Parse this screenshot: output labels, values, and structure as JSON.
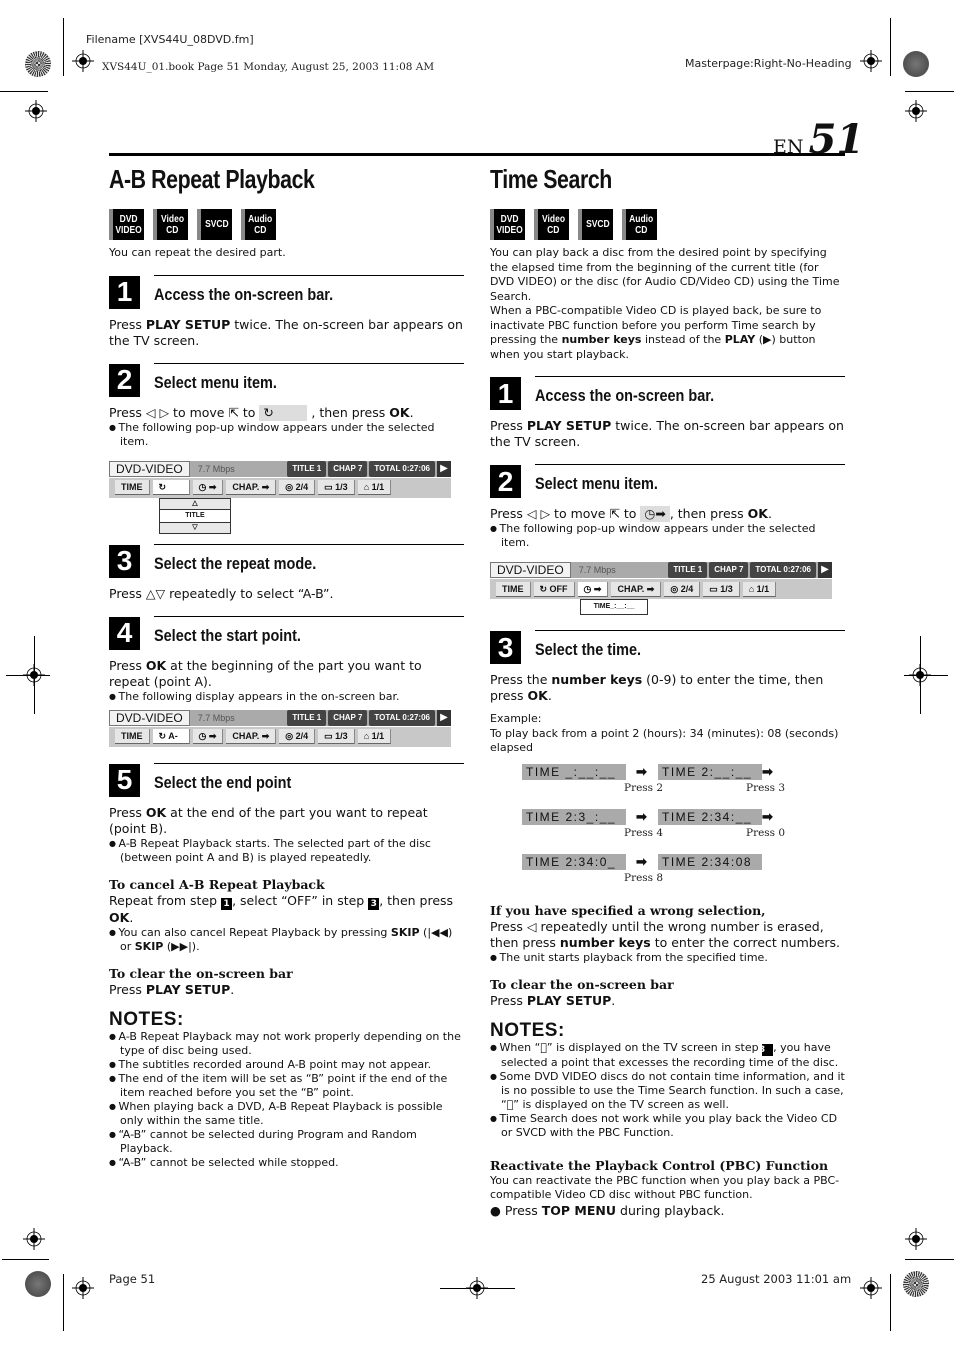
{
  "header": {
    "filename": "Filename [XVS44U_08DVD.fm]",
    "book_info": "XVS44U_01.book  Page 51  Monday, August 25, 2003  11:08 AM",
    "masterpage": "Masterpage:Right-No-Heading",
    "lang": "EN",
    "page_number": "51"
  },
  "footer": {
    "page_label": "Page 51",
    "date": "25 August 2003 11:01 am"
  },
  "badges": [
    {
      "line1": "DVD",
      "line2": "VIDEO"
    },
    {
      "line1": "Video",
      "line2": "CD"
    },
    {
      "line1": "SVCD",
      "line2": ""
    },
    {
      "line1": "Audio",
      "line2": "CD"
    }
  ],
  "ab_repeat": {
    "title": "A-B Repeat Playback",
    "intro": "You can repeat the desired part.",
    "steps": [
      {
        "num": "1",
        "title": "Access the on-screen bar.",
        "body_pre": "Press ",
        "body_bold": "PLAY SETUP",
        "body_post": " twice. The on-screen bar appears on the TV screen."
      },
      {
        "num": "2",
        "title": "Select menu item.",
        "body_pre": "Press ◁ ▷ to move ⇱ to ",
        "body_icon": "↻",
        "body_post": " , then press ",
        "body_ok": "OK",
        "bullet": "The following pop-up window appears under the selected item."
      },
      {
        "num": "3",
        "title": "Select the repeat mode.",
        "body": "Press △▽ repeatedly to select “A-B”."
      },
      {
        "num": "4",
        "title": "Select the start point.",
        "body_pre": "Press ",
        "body_bold": "OK",
        "body_post": " at the beginning of the part you want to repeat (point A).",
        "bullet": "The following display appears in the on-screen bar."
      },
      {
        "num": "5",
        "title": "Select the end point",
        "body_pre": "Press ",
        "body_bold": "OK",
        "body_post": " at the end of the part you want to repeat (point B).",
        "bullet": "A-B Repeat Playback starts. The selected part of the disc (between point A and B) is played repeatedly."
      }
    ],
    "cancel": {
      "heading": "To cancel A-B Repeat Playback",
      "body_pre": "Repeat from step ",
      "step_a": "1",
      "body_mid": ", select “OFF” in step ",
      "step_b": "3",
      "body_post": ", then press ",
      "ok": "OK",
      "bullet_pre": "You can also cancel Repeat Playback by pressing ",
      "skip1": "SKIP",
      "skip1_sym": " (|◀◀)",
      "bullet_mid": " or ",
      "skip2": "SKIP",
      "skip2_sym": " (▶▶|)."
    },
    "clear": {
      "heading": "To clear the on-screen bar",
      "body_pre": "Press ",
      "body_bold": "PLAY SETUP",
      "body_post": "."
    },
    "notes_title": "NOTES:",
    "notes": [
      "A-B Repeat Playback may not work properly depending on the type of disc being used.",
      "The subtitles recorded around A-B point may not appear.",
      "The end of the item will be set as “B” point if the end of the item reached before you set the “B” point.",
      "When playing back a DVD, A-B Repeat Playback is possible only within the same title.",
      "“A-B” cannot be selected during Program and Random Playback.",
      "“A-B” cannot be selected while stopped."
    ]
  },
  "osb": {
    "disc": "DVD-VIDEO",
    "rate": "7.7 Mbps",
    "title": "TITLE    1",
    "chap": "CHAP    7",
    "total": "TOTAL   0:27:06",
    "play": "▶",
    "time": "TIME",
    "repeat": "↻",
    "repeat_ab": "↻ A-",
    "repeat_off": "↻ OFF",
    "timesearch": "◷ ➡",
    "chapsearch": "CHAP. ➡",
    "audio": "◎ 2/4",
    "subtitle": "▭ 1/3",
    "angle": "⌂ 1/1",
    "popup_title": "TITLE",
    "popup_up": "△",
    "popup_down": "▽",
    "popup_time": "TIME_:__:__"
  },
  "time_search": {
    "title": "Time Search",
    "intro1": "You can play back a disc from the desired point by specifying the elapsed time from the beginning of the current title (for DVD VIDEO) or the disc (for Audio CD/Video CD) using the Time Search.",
    "intro2_pre": "When a PBC-compatible Video CD is played back, be sure to inactivate PBC function before you perform Time search by pressing the ",
    "intro2_b1": "number keys",
    "intro2_mid": " instead of the ",
    "intro2_b2": "PLAY",
    "intro2_post": " (▶) button when you start playback.",
    "steps": [
      {
        "num": "1",
        "title": "Access the on-screen bar.",
        "body_pre": "Press ",
        "body_bold": "PLAY SETUP",
        "body_post": " twice. The on-screen bar appears on the TV screen."
      },
      {
        "num": "2",
        "title": "Select menu item.",
        "body_pre": "Press ◁ ▷ to move ⇱ to ",
        "body_icon": "◷➡",
        "body_post": ", then press ",
        "body_ok": "OK",
        "bullet": "The following pop-up window appears under the selected item."
      },
      {
        "num": "3",
        "title": "Select the time.",
        "body_pre": "Press the ",
        "body_bold": "number keys",
        "body_mid": " (0-9) to enter the time, then press ",
        "body_ok": "OK",
        "example_label": "Example:",
        "example_text": "To play back from a point 2 (hours): 34 (minutes): 08 (seconds) elapsed"
      }
    ],
    "sequence": [
      {
        "display": "TIME  _:__:__",
        "press": "Press 2"
      },
      {
        "display": "TIME  2:__:__",
        "press": "Press 3"
      },
      {
        "display": "TIME  2:3_:__",
        "press": "Press 4"
      },
      {
        "display": "TIME  2:34:__",
        "press": "Press 0"
      },
      {
        "display": "TIME  2:34:0_",
        "press": "Press 8"
      },
      {
        "display": "TIME  2:34:08",
        "press": ""
      }
    ],
    "arrow": "➡",
    "wrong": {
      "heading": "If you have specified a wrong selection,",
      "body_pre": "Press ◁ repeatedly until the wrong number is erased, then press ",
      "body_bold": "number keys",
      "body_post": " to enter the correct numbers.",
      "bullet": "The unit starts playback from the specified time."
    },
    "clear": {
      "heading": "To clear the on-screen bar",
      "body_pre": "Press ",
      "body_bold": "PLAY SETUP",
      "body_post": "."
    },
    "notes_title": "NOTES:",
    "notes": [
      {
        "pre": "When “⃠” is displayed on the TV screen in step ",
        "step": "3",
        "post": ", you have selected a point that excesses the recording time of the disc."
      },
      {
        "pre": "Some DVD VIDEO discs do not contain time information, and it is no possible to use the Time Search function. In such a case, “⃠” is displayed on the TV screen as well.",
        "step": "",
        "post": ""
      },
      {
        "pre": "Time Search does not work while you play back the Video CD or SVCD with the PBC Function.",
        "step": "",
        "post": ""
      }
    ],
    "pbc": {
      "heading": "Reactivate the Playback Control (PBC) Function",
      "body": "You can reactivate the PBC function when you play back a PBC-compatible Video CD disc without PBC function.",
      "bullet_pre": "Press ",
      "bullet_bold": "TOP MENU",
      "bullet_post": " during playback."
    }
  }
}
